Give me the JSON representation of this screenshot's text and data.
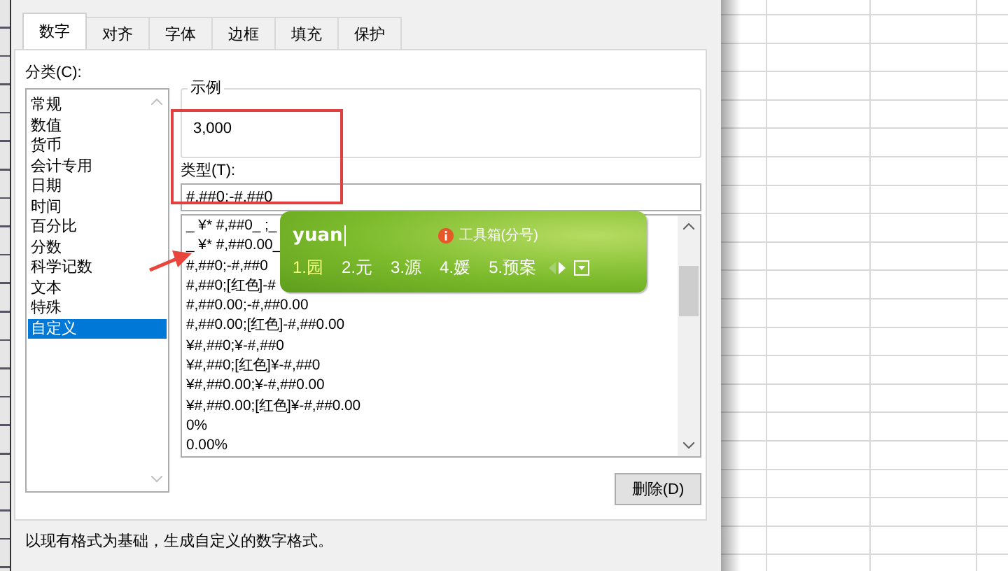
{
  "tabs": [
    {
      "label": "数字",
      "selected": true
    },
    {
      "label": "对齐",
      "selected": false
    },
    {
      "label": "字体",
      "selected": false
    },
    {
      "label": "边框",
      "selected": false
    },
    {
      "label": "填充",
      "selected": false
    },
    {
      "label": "保护",
      "selected": false
    }
  ],
  "category": {
    "label": "分类(C):",
    "items": [
      {
        "label": "常规",
        "selected": false
      },
      {
        "label": "数值",
        "selected": false
      },
      {
        "label": "货币",
        "selected": false
      },
      {
        "label": "会计专用",
        "selected": false
      },
      {
        "label": "日期",
        "selected": false
      },
      {
        "label": "时间",
        "selected": false
      },
      {
        "label": "百分比",
        "selected": false
      },
      {
        "label": "分数",
        "selected": false
      },
      {
        "label": "科学记数",
        "selected": false
      },
      {
        "label": "文本",
        "selected": false
      },
      {
        "label": "特殊",
        "selected": false
      },
      {
        "label": "自定义",
        "selected": true
      }
    ]
  },
  "sample": {
    "label": "示例",
    "value": "3,000"
  },
  "type": {
    "label": "类型(T):",
    "value": "#,##0;-#,##0",
    "items": [
      "_ ¥* #,##0_ ;_",
      "_ ¥* #,##0.00_",
      "#,##0;-#,##0",
      "#,##0;[红色]-#",
      "#,##0.00;-#,##0.00",
      "#,##0.00;[红色]-#,##0.00",
      "¥#,##0;¥-#,##0",
      "¥#,##0;[红色]¥-#,##0",
      "¥#,##0.00;¥-#,##0.00",
      "¥#,##0.00;[红色]¥-#,##0.00",
      "0%",
      "0.00%"
    ]
  },
  "ime": {
    "input": "yuan",
    "toolbox": "工具箱(分号)",
    "candidates": [
      {
        "label": "1.园",
        "selected": true
      },
      {
        "label": "2.元",
        "selected": false
      },
      {
        "label": "3.源",
        "selected": false
      },
      {
        "label": "4.媛",
        "selected": false
      },
      {
        "label": "5.预案",
        "selected": false
      }
    ]
  },
  "delete_button": "删除(D)",
  "hint": "以现有格式为基础，生成自定义的数字格式。"
}
